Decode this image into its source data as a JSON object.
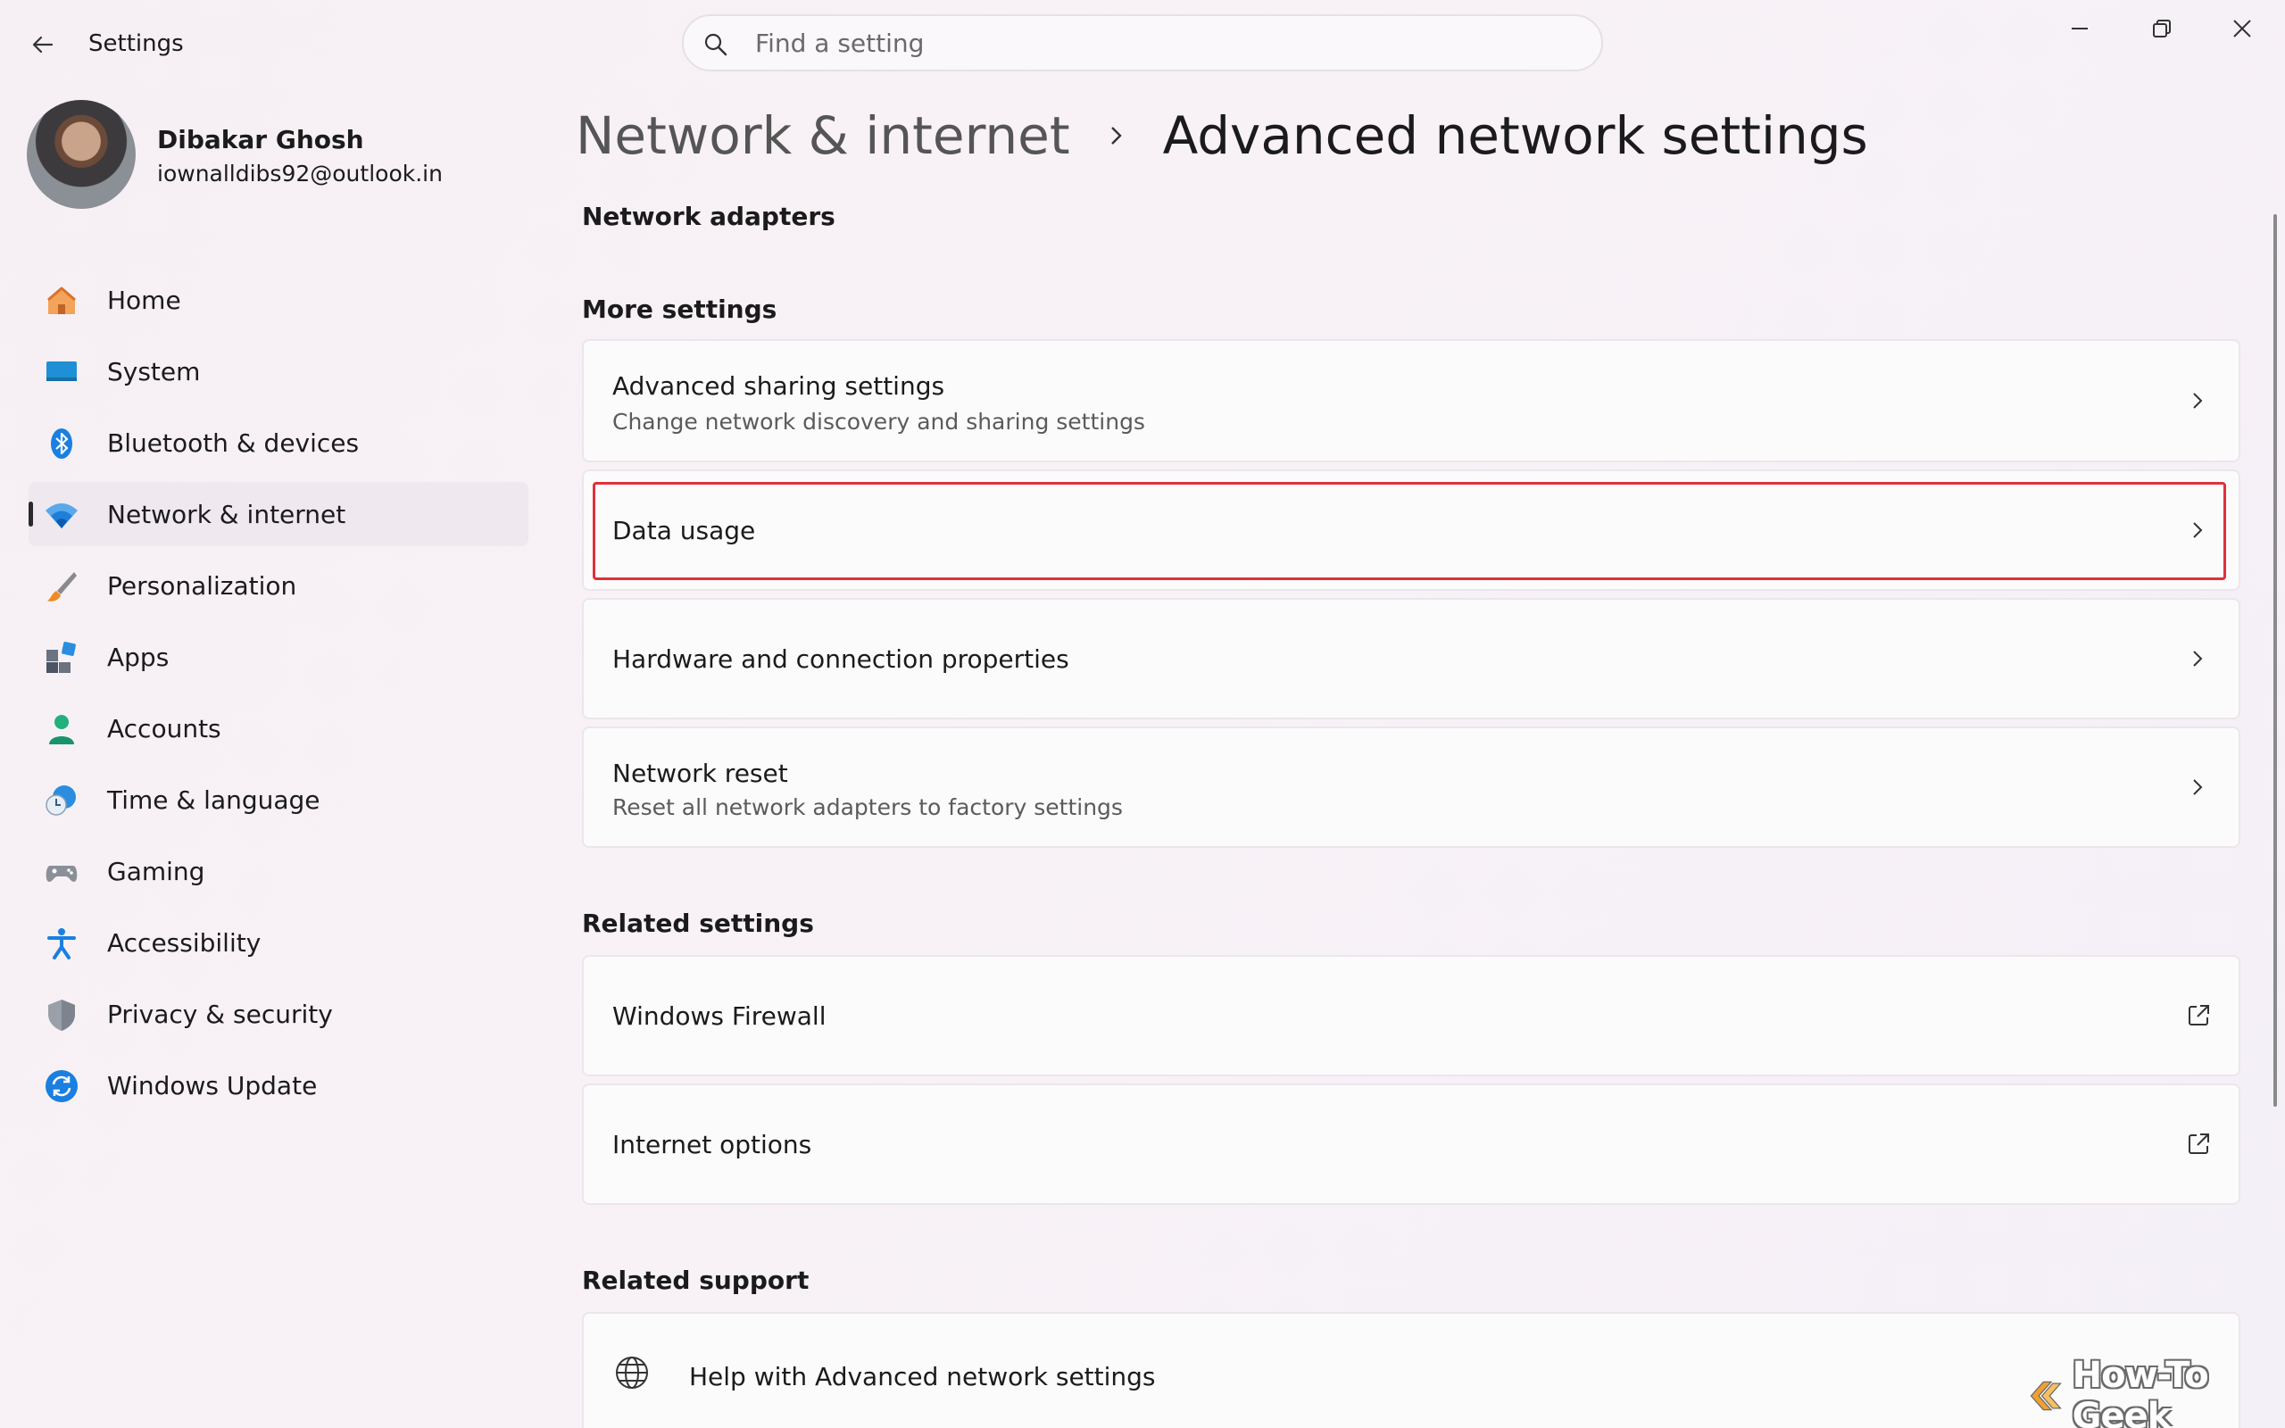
{
  "app": {
    "title": "Settings"
  },
  "search": {
    "placeholder": "Find a setting",
    "value": ""
  },
  "window_controls": {
    "minimize_icon": "minimize-icon",
    "restore_icon": "restore-icon",
    "close_icon": "close-icon"
  },
  "profile": {
    "name": "Dibakar Ghosh",
    "email": "iownalldibs92@outlook.in"
  },
  "sidebar": {
    "items": [
      {
        "label": "Home",
        "icon": "home-icon"
      },
      {
        "label": "System",
        "icon": "system-icon"
      },
      {
        "label": "Bluetooth & devices",
        "icon": "bluetooth-icon"
      },
      {
        "label": "Network & internet",
        "icon": "wifi-icon",
        "selected": true
      },
      {
        "label": "Personalization",
        "icon": "brush-icon"
      },
      {
        "label": "Apps",
        "icon": "apps-icon"
      },
      {
        "label": "Accounts",
        "icon": "accounts-icon"
      },
      {
        "label": "Time & language",
        "icon": "time-language-icon"
      },
      {
        "label": "Gaming",
        "icon": "gaming-icon"
      },
      {
        "label": "Accessibility",
        "icon": "accessibility-icon"
      },
      {
        "label": "Privacy & security",
        "icon": "shield-icon"
      },
      {
        "label": "Windows Update",
        "icon": "update-icon"
      }
    ]
  },
  "breadcrumb": {
    "parent": "Network & internet",
    "current": "Advanced network settings"
  },
  "sections": {
    "network_adapters": "Network adapters",
    "more_settings": "More settings",
    "related_settings": "Related settings",
    "related_support": "Related support"
  },
  "more_settings": {
    "advanced_sharing": {
      "title": "Advanced sharing settings",
      "subtitle": "Change network discovery and sharing settings"
    },
    "data_usage": {
      "title": "Data usage"
    },
    "hardware": {
      "title": "Hardware and connection properties"
    },
    "network_reset": {
      "title": "Network reset",
      "subtitle": "Reset all network adapters to factory settings"
    }
  },
  "related_settings": {
    "firewall": {
      "title": "Windows Firewall"
    },
    "internet_options": {
      "title": "Internet options"
    }
  },
  "related_support": {
    "help": {
      "title": "Help with Advanced network settings"
    }
  },
  "watermark": {
    "text": "How-To Geek"
  },
  "colors": {
    "accent": "#0067c0",
    "highlight": "#e0313a",
    "selected_bg": "#efe8ee"
  }
}
